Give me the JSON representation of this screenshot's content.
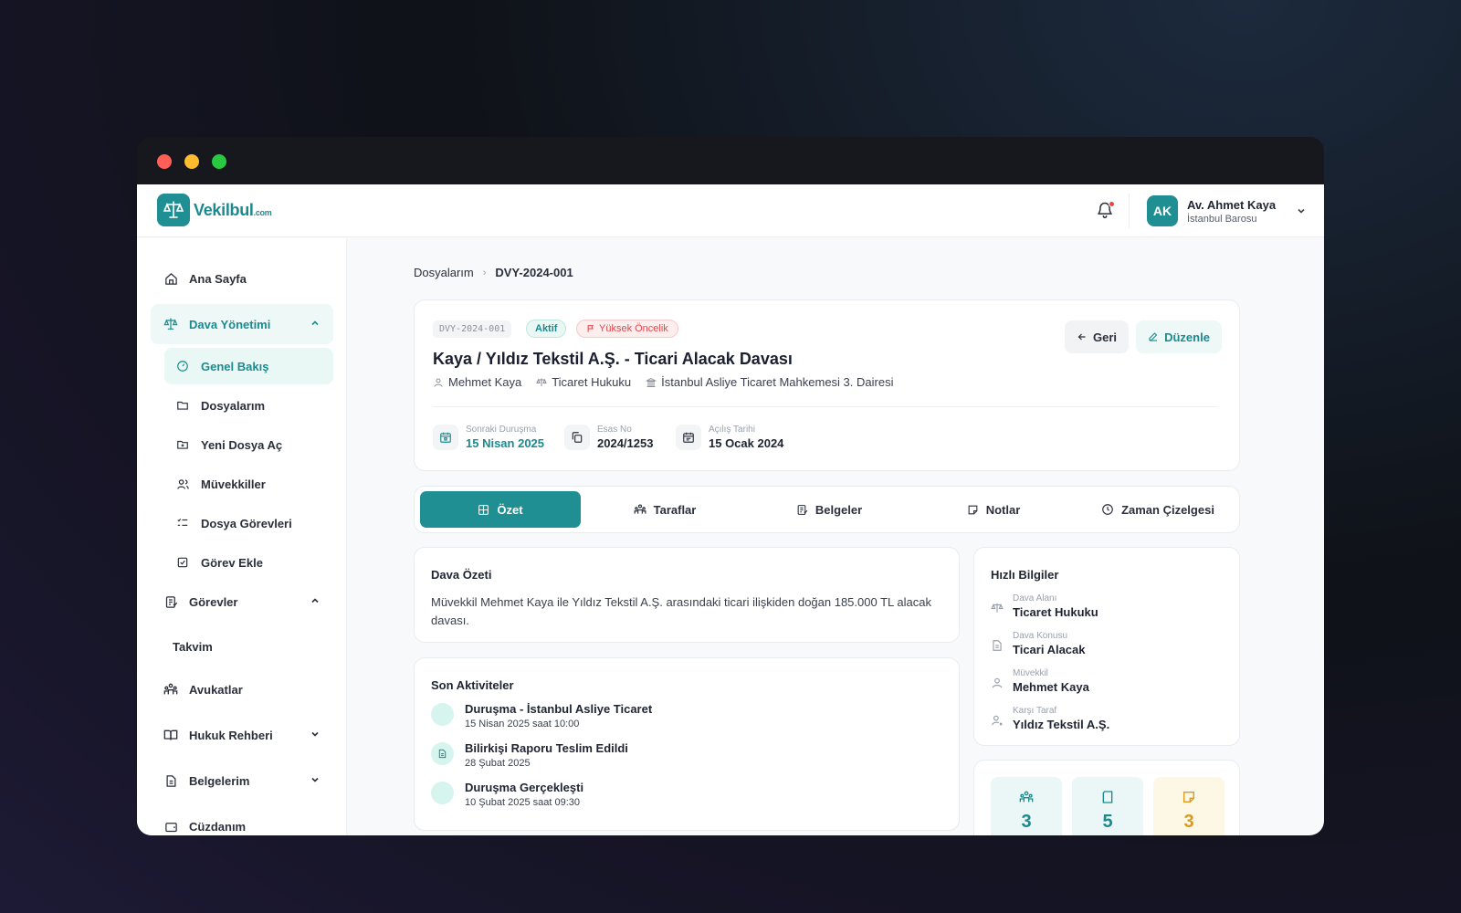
{
  "brand": {
    "name": "Vekilbul",
    "suffix": ".com"
  },
  "user": {
    "initials": "AK",
    "name": "Av. Ahmet Kaya",
    "org": "İstanbul Barosu"
  },
  "sidebar": {
    "home": "Ana Sayfa",
    "case_mgmt": "Dava Yönetimi",
    "case_items": [
      "Genel Bakış",
      "Dosyalarım",
      "Yeni Dosya Aç",
      "Müvekkiller",
      "Dosya Görevleri",
      "Görev Ekle"
    ],
    "tasks": "Görevler",
    "calendar": "Takvim",
    "lawyers": "Avukatlar",
    "guide": "Hukuk Rehberi",
    "docs": "Belgelerim",
    "wallet": "Cüzdanım"
  },
  "breadcrumb": {
    "parent": "Dosyalarım",
    "current": "DVY-2024-001"
  },
  "case": {
    "code": "DVY-2024-001",
    "status": "Aktif",
    "priority": "Yüksek Öncelik",
    "title": "Kaya / Yıldız Tekstil A.Ş. - Ticari Alacak Davası",
    "client": "Mehmet Kaya",
    "field": "Ticaret Hukuku",
    "court": "İstanbul Asliye Ticaret Mahkemesi 3. Dairesi",
    "back_label": "Geri",
    "edit_label": "Düzenle",
    "stats": [
      {
        "label": "Sonraki Duruşma",
        "value": "15 Nisan 2025"
      },
      {
        "label": "Esas No",
        "value": "2024/1253"
      },
      {
        "label": "Açılış Tarihi",
        "value": "15 Ocak 2024"
      }
    ]
  },
  "tabs": [
    "Özet",
    "Taraflar",
    "Belgeler",
    "Notlar",
    "Zaman Çizelgesi"
  ],
  "summary": {
    "title": "Dava Özeti",
    "text": "Müvekkil Mehmet Kaya ile Yıldız Tekstil A.Ş. arasındaki ticari ilişkiden doğan 185.000 TL alacak davası."
  },
  "activities": {
    "title": "Son Aktiviteler",
    "items": [
      {
        "title": "Duruşma - İstanbul Asliye Ticaret",
        "date": "15 Nisan 2025 saat 10:00"
      },
      {
        "title": "Bilirkişi Raporu Teslim Edildi",
        "date": "28 Şubat 2025"
      },
      {
        "title": "Duruşma Gerçekleşti",
        "date": "10 Şubat 2025 saat 09:30"
      }
    ]
  },
  "quick": {
    "title": "Hızlı Bilgiler",
    "items": [
      {
        "label": "Dava Alanı",
        "value": "Ticaret Hukuku"
      },
      {
        "label": "Dava Konusu",
        "value": "Ticari Alacak"
      },
      {
        "label": "Müvekkil",
        "value": "Mehmet Kaya"
      },
      {
        "label": "Karşı Taraf",
        "value": "Yıldız Tekstil A.Ş."
      }
    ]
  },
  "counts": {
    "parties": "3",
    "documents": "5",
    "notes": "3"
  },
  "colors": {
    "accent": "#1f8f94",
    "danger": "#e0474c",
    "warning": "#d99a1c"
  }
}
